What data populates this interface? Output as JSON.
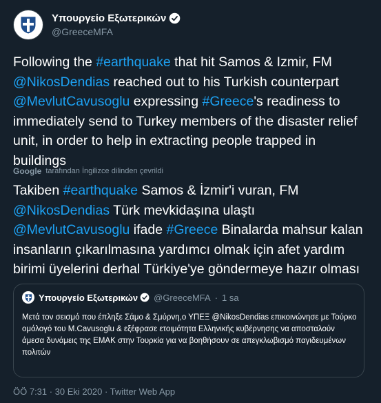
{
  "account": {
    "name": "Υπουργείο Εξωτερικών",
    "handle": "@GreeceMFA"
  },
  "tweet": {
    "parts": [
      {
        "text": "Following the ",
        "link": false
      },
      {
        "text": "#earthquake",
        "link": true
      },
      {
        "text": " that hit Samos & Izmir, FM ",
        "link": false
      },
      {
        "text": "@NikosDendias",
        "link": true
      },
      {
        "text": " reached out to his Turkish counterpart ",
        "link": false
      },
      {
        "text": "@MevlutCavusoglu",
        "link": true
      },
      {
        "text": " expressing ",
        "link": false
      },
      {
        "text": "#Greece",
        "link": true
      },
      {
        "text": "'s readiness to immediately send to Turkey members of the disaster relief unit, in order to help in extracting people trapped in buildings",
        "link": false
      }
    ]
  },
  "translation_note": {
    "brand": "Google",
    "text": "tarafından İngilizce dilinden çevrildi"
  },
  "translated": {
    "parts": [
      {
        "text": "Takiben ",
        "link": false
      },
      {
        "text": "#earthquake",
        "link": true
      },
      {
        "text": " Samos & İzmir'i vuran, FM ",
        "link": false
      },
      {
        "text": "@NikosDendias",
        "link": true
      },
      {
        "text": " Türk mevkidaşına ulaştı ",
        "link": false
      },
      {
        "text": "@MevlutCavusoglu",
        "link": true
      },
      {
        "text": " ifade ",
        "link": false
      },
      {
        "text": "#Greece",
        "link": true
      },
      {
        "text": " Binalarda mahsur kalan insanların çıkarılmasına yardımcı olmak için afet yardım birimi üyelerini derhal Türkiye'ye göndermeye hazır olması",
        "link": false
      }
    ]
  },
  "quote": {
    "name": "Υπουργείο Εξωτερικών",
    "handle": "@GreeceMFA",
    "separator": "·",
    "time": "1 sa",
    "text": "Μετά τον σεισμό που έπληξε Σάμο & Σμύρνη,ο ΥΠΕΞ @NikosDendias επικοινώνησε με Τούρκο ομόλογό του Μ.Cavusoglu & εξέφρασε ετοιμότητα Ελληνικής κυβέρνησης να αποσταλούν άμεσα δυνάμεις της ΕΜΑΚ στην Τουρκία για να βοηθήσουν σε απεγκλωβισμό παγιδευμένων πολιτών"
  },
  "footer": {
    "text": "ÖÖ 7:31 · 30 Eki 2020 · Twitter Web App"
  },
  "colors": {
    "background": "#15202b",
    "link": "#1da1f2",
    "muted": "#8899a6",
    "border": "#38444d"
  }
}
